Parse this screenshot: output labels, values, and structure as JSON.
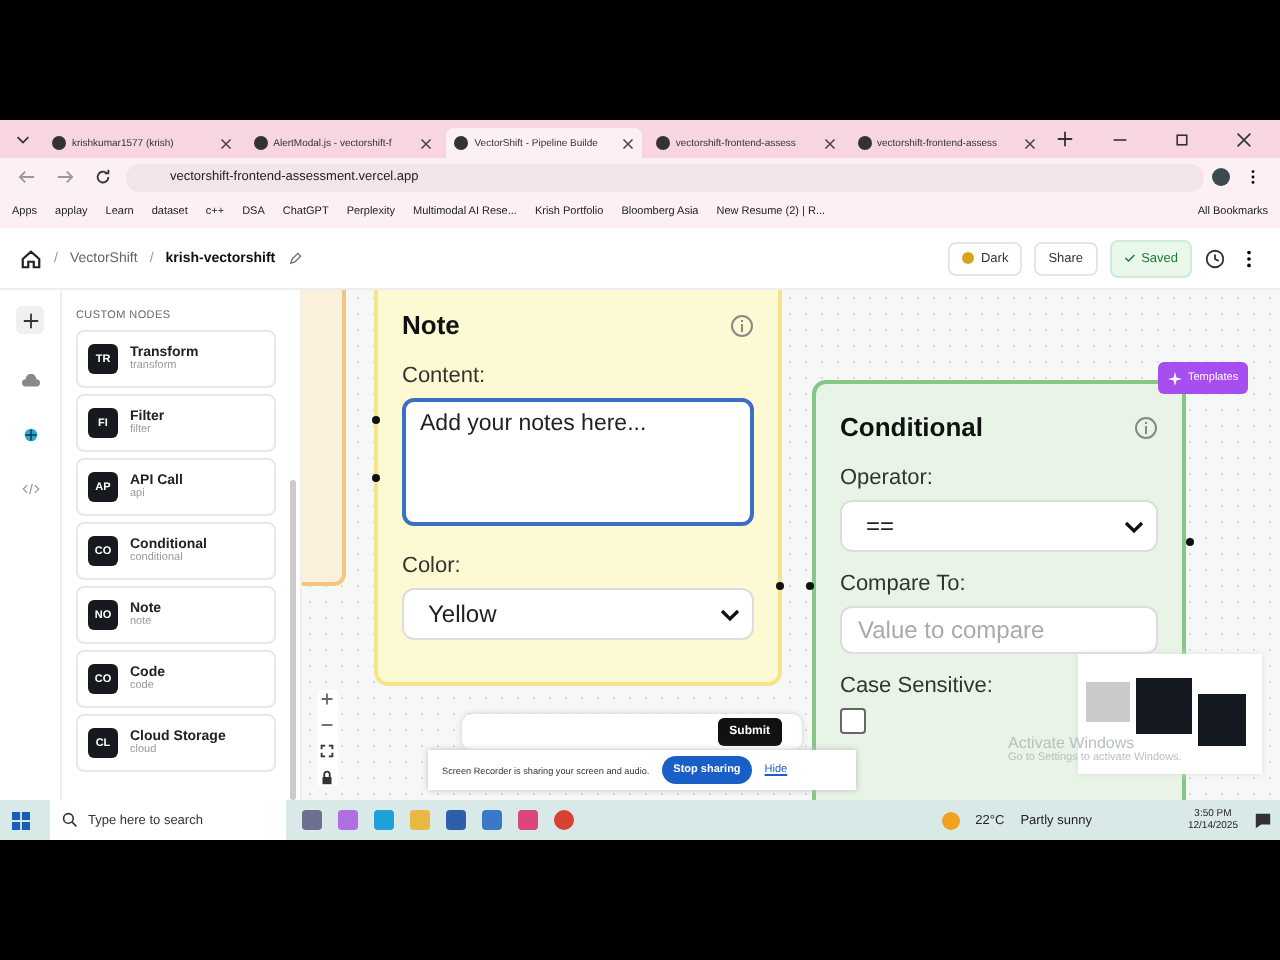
{
  "browser": {
    "tabs": [
      {
        "title": "krishkumar1577 (krish)",
        "selected": false
      },
      {
        "title": "AlertModal.js - vectorshift-f",
        "selected": false
      },
      {
        "title": "VectorShift - Pipeline Builde",
        "selected": true
      },
      {
        "title": "vectorshift-frontend-assess",
        "selected": false
      },
      {
        "title": "vectorshift-frontend-assess",
        "selected": false
      }
    ],
    "url": "vectorshift-frontend-assessment.vercel.app",
    "bookmarks": [
      "Apps",
      "applay",
      "Learn",
      "dataset",
      "c++",
      "DSA",
      "ChatGPT",
      "Perplexity",
      "Multimodal AI Rese...",
      "Krish Portfolio",
      "Bloomberg Asia",
      "New Resume (2) | R..."
    ],
    "all_bookmarks": "All Bookmarks"
  },
  "header": {
    "separator": "/",
    "workspace": "VectorShift",
    "project": "krish-vectorshift",
    "dark_button": "Dark",
    "share_button": "Share",
    "saved_button": "Saved"
  },
  "sidebar": {
    "section_label": "CUSTOM NODES",
    "nodes": [
      {
        "badge": "TR",
        "name": "Transform",
        "type": "transform"
      },
      {
        "badge": "FI",
        "name": "Filter",
        "type": "filter"
      },
      {
        "badge": "AP",
        "name": "API Call",
        "type": "api"
      },
      {
        "badge": "CO",
        "name": "Conditional",
        "type": "conditional"
      },
      {
        "badge": "NO",
        "name": "Note",
        "type": "note"
      },
      {
        "badge": "CO",
        "name": "Code",
        "type": "code"
      },
      {
        "badge": "CL",
        "name": "Cloud Storage",
        "type": "cloud"
      }
    ]
  },
  "note_node": {
    "title": "Note",
    "content_label": "Content:",
    "content_placeholder": "Add your notes here...",
    "color_label": "Color:",
    "color_value": "Yellow"
  },
  "conditional_node": {
    "title": "Conditional",
    "operator_label": "Operator:",
    "operator_value": "==",
    "compare_label": "Compare To:",
    "compare_placeholder": "Value to compare",
    "case_label": "Case Sensitive:",
    "case_checked": false
  },
  "templates_button": "Templates",
  "submit_button": "Submit",
  "screen_recorder": {
    "message": "Screen Recorder is sharing your screen and audio.",
    "stop_button": "Stop sharing",
    "hide_link": "Hide"
  },
  "watermark": {
    "title": "Activate Windows",
    "subtitle": "Go to Settings to activate Windows."
  },
  "taskbar": {
    "search_placeholder": "Type here to search",
    "temperature": "22°C",
    "weather": "Partly sunny",
    "time": "3:50 PM",
    "date": "12/14/2025"
  }
}
